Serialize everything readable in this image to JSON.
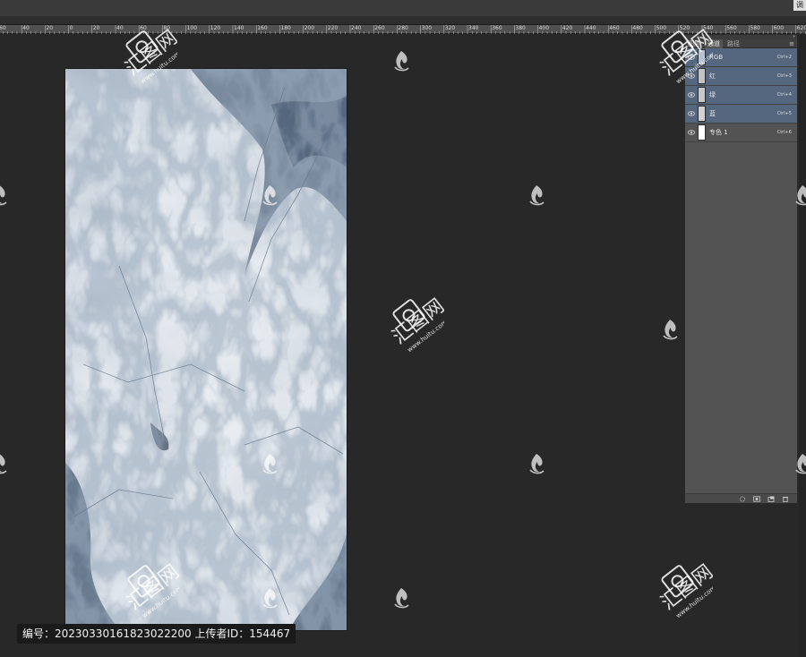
{
  "window": {
    "edge_button_label": "调"
  },
  "ruler": {
    "labels": [
      "60",
      "40",
      "20",
      "0",
      "20",
      "40",
      "60",
      "80",
      "100",
      "120",
      "140",
      "160",
      "180",
      "200",
      "220",
      "240",
      "260",
      "280",
      "300",
      "320",
      "340",
      "360",
      "380",
      "400",
      "420",
      "440",
      "460",
      "480",
      "500",
      "520",
      "540",
      "560",
      "580",
      "600",
      "620"
    ]
  },
  "panel": {
    "tabs": [
      {
        "label": "图层",
        "active": false
      },
      {
        "label": "通道",
        "active": true
      },
      {
        "label": "路径",
        "active": false
      }
    ],
    "menu_icon": "panel-menu-icon",
    "channels": [
      {
        "name": "RGB",
        "shortcut": "Ctrl+2",
        "selected": true,
        "visible": true,
        "thumb_color": "#b9c3cf"
      },
      {
        "name": "红",
        "shortcut": "Ctrl+3",
        "selected": true,
        "visible": true,
        "thumb_color": "#c3c3c3"
      },
      {
        "name": "绿",
        "shortcut": "Ctrl+4",
        "selected": true,
        "visible": true,
        "thumb_color": "#c8c8c8"
      },
      {
        "name": "蓝",
        "shortcut": "Ctrl+5",
        "selected": true,
        "visible": true,
        "thumb_color": "#d2d2d2"
      },
      {
        "name": "专色 1",
        "shortcut": "Ctrl+6",
        "selected": false,
        "visible": true,
        "thumb_color": "#ffffff"
      }
    ],
    "footer_icons": [
      "load-selection-icon",
      "save-selection-icon",
      "new-channel-icon",
      "delete-channel-icon"
    ]
  },
  "watermark": {
    "brand": "汇图网",
    "domain": "www.huitu.com"
  },
  "caption": {
    "text": "编号：20230330161823022200  上传者ID：154467"
  },
  "colors": {
    "app_background": "#282828",
    "panel": "#535353",
    "selected_row": "#55677f",
    "marble_base": "#c9d2dc",
    "marble_vein": "#50647a"
  }
}
